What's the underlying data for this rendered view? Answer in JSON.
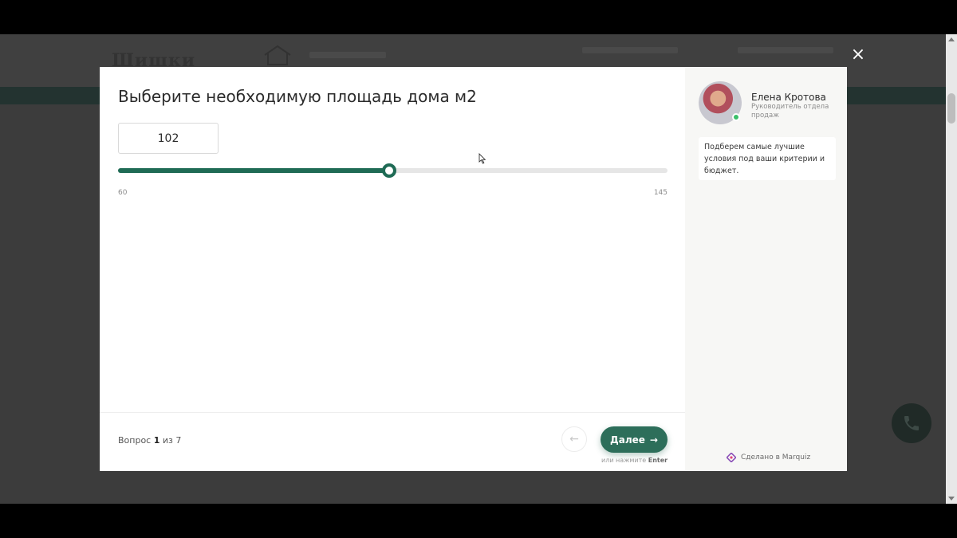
{
  "background": {
    "logo_text": "Шишки"
  },
  "modal": {
    "close_label": "×",
    "question": {
      "title": "Выберите необходимую площадь дома м2",
      "input_value": "102",
      "slider": {
        "min": 60,
        "max": 145,
        "value": 102
      },
      "min_label": "60",
      "max_label": "145"
    },
    "footer": {
      "progress_prefix": "Вопрос",
      "progress_current": "1",
      "progress_middle": "из",
      "progress_total": "7",
      "back_label": "←",
      "next_label": "Далее",
      "next_arrow": "→",
      "hint_prefix": "или нажмите",
      "hint_key": "Enter"
    },
    "manager": {
      "name": "Елена Кротова",
      "role": "Руководитель отдела продаж",
      "message": "Подберем самые лучшие условия под ваши критерии и бюджет."
    },
    "branding": {
      "made_in": "Сделано в Marquiz"
    }
  },
  "colors": {
    "accent": "#1f6b55",
    "button": "#2d6e5a",
    "online": "#3bbf6a"
  },
  "icons": [
    "close-icon",
    "arrow-left-icon",
    "arrow-right-icon",
    "phone-icon",
    "marquiz-logo-icon",
    "cursor-icon",
    "house-icon"
  ]
}
